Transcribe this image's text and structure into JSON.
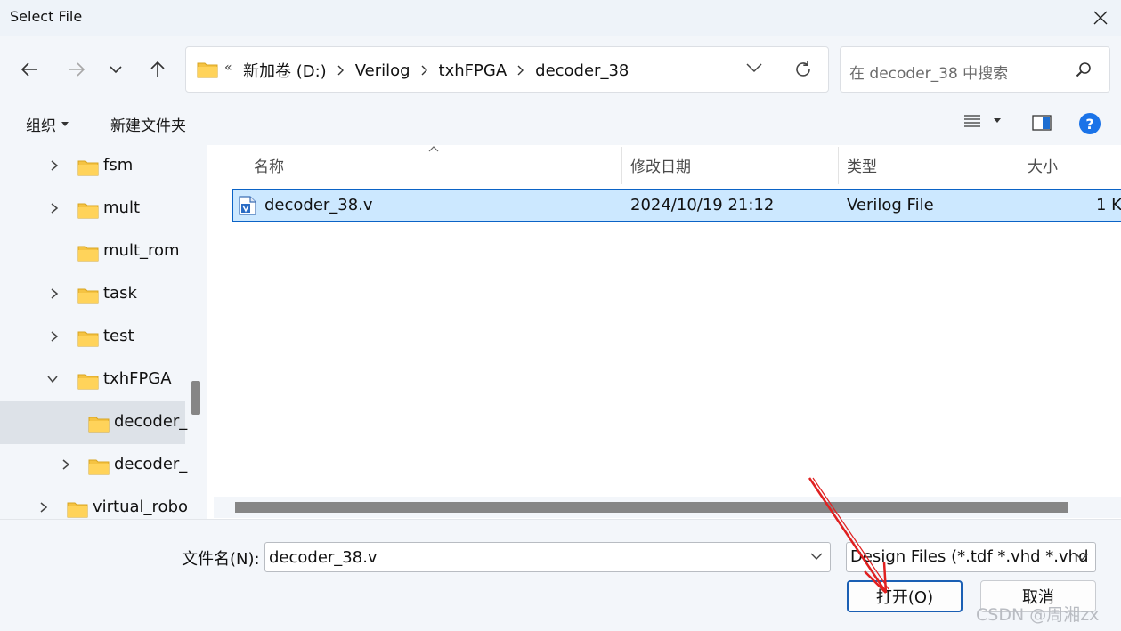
{
  "window": {
    "title": "Select File"
  },
  "address_bar": {
    "overflow": "«",
    "crumbs": [
      "新加卷 (D:)",
      "Verilog",
      "txhFPGA",
      "decoder_38"
    ]
  },
  "search": {
    "placeholder": "在 decoder_38 中搜索"
  },
  "toolbar": {
    "organize": "组织",
    "new_folder": "新建文件夹"
  },
  "sidebar": {
    "items": [
      {
        "label": "fsm",
        "expander": "collapsed"
      },
      {
        "label": "mult",
        "expander": "collapsed"
      },
      {
        "label": "mult_rom",
        "expander": "none"
      },
      {
        "label": "task",
        "expander": "collapsed"
      },
      {
        "label": "test",
        "expander": "collapsed"
      },
      {
        "label": "txhFPGA",
        "expander": "expanded"
      },
      {
        "label": "decoder_",
        "expander": "none",
        "selected": true
      },
      {
        "label": "decoder_",
        "expander": "collapsed"
      },
      {
        "label": "virtual_robo",
        "expander": "collapsed"
      }
    ]
  },
  "file_list": {
    "columns": [
      "名称",
      "修改日期",
      "类型",
      "大小"
    ],
    "rows": [
      {
        "name": "decoder_38.v",
        "modified": "2024/10/19 21:12",
        "type": "Verilog File",
        "size": "1 K"
      }
    ]
  },
  "footer": {
    "filename_label": "文件名(N):",
    "filename_value": "decoder_38.v",
    "file_type": "Design Files (*.tdf *.vhd *.vhd",
    "open_button": "打开(O)",
    "cancel_button": "取消"
  },
  "watermark": "CSDN @周湘zx",
  "colors": {
    "accent": "#0b63c6",
    "selection": "#cce8ff",
    "annotation_arrow": "#e02020",
    "folder": "#f5c342"
  }
}
